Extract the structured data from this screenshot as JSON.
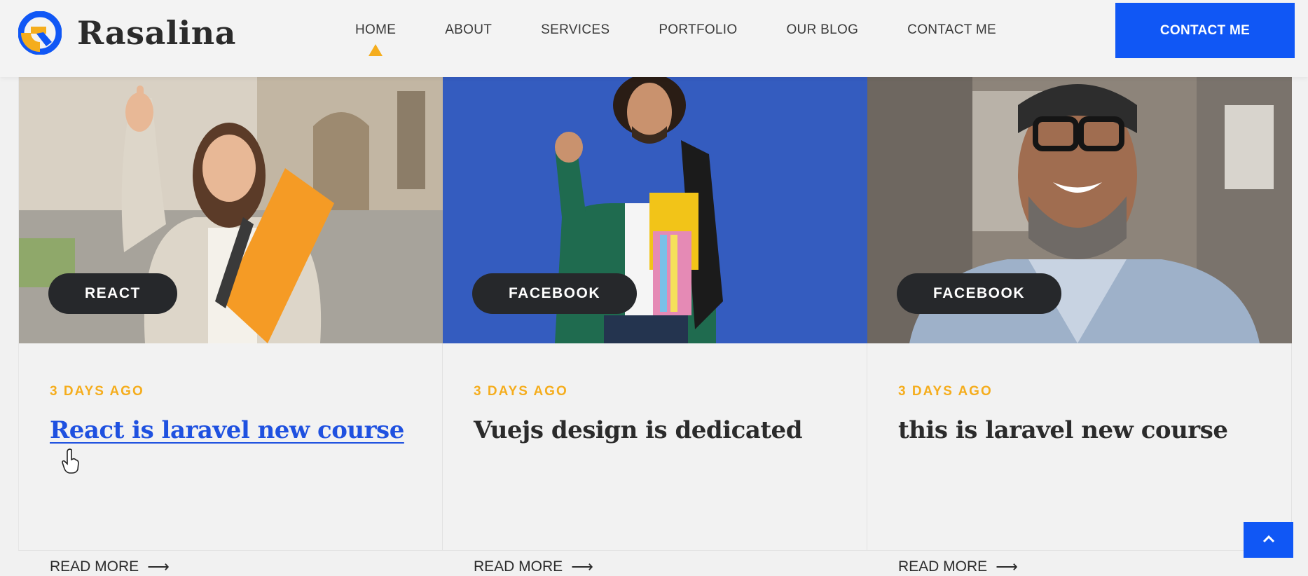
{
  "brand": {
    "name": "Rasalina",
    "primary_color": "#1057f5",
    "accent_color": "#f5ad1d"
  },
  "nav": {
    "items": [
      {
        "label": "HOME",
        "active": true
      },
      {
        "label": "ABOUT"
      },
      {
        "label": "SERVICES"
      },
      {
        "label": "PORTFOLIO"
      },
      {
        "label": "OUR BLOG"
      },
      {
        "label": "CONTACT ME"
      }
    ],
    "cta_label": "CONTACT ME"
  },
  "posts": [
    {
      "category": "REACT",
      "date": "3 DAYS AGO",
      "title": "React is laravel new course",
      "read_more": "READ MORE",
      "image": "woman-with-orange-folder-thumbs-up",
      "hovered": true
    },
    {
      "category": "FACEBOOK",
      "date": "3 DAYS AGO",
      "title": "Vuejs design is dedicated",
      "read_more": "READ MORE",
      "image": "student-with-backpack-on-blue-background"
    },
    {
      "category": "FACEBOOK",
      "date": "3 DAYS AGO",
      "title": "this is laravel new course",
      "read_more": "READ MORE",
      "image": "smiling-man-with-glasses"
    }
  ],
  "icons": {
    "arrow": "arrow-right-icon",
    "back_to_top": "chevron-up-icon",
    "cursor": "hand-pointer-icon"
  }
}
